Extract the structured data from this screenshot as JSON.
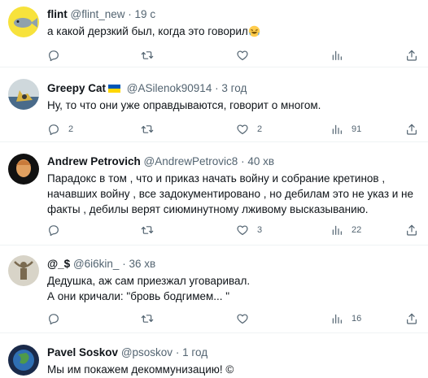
{
  "tweets": [
    {
      "name": "flint",
      "handle": "@flint_new",
      "sep": "·",
      "time": "19 с",
      "text": "а какой дерзкий был, когда это говорил",
      "emoji": "rolling-laughing-emoji",
      "reply_count": "",
      "retweet_count": "",
      "like_count": "",
      "view_count": ""
    },
    {
      "name": "Greepy Cat",
      "flag": "ukraine-flag",
      "handle": "@ASilenok90914",
      "sep": "·",
      "time": "3 год",
      "text": "Ну, то что они уже оправдываются, говорит о многом.",
      "reply_count": "2",
      "retweet_count": "",
      "like_count": "2",
      "view_count": "91"
    },
    {
      "name": "Andrew Petrovich",
      "handle": "@AndrewPetrovic8",
      "sep": "·",
      "time": "40 хв",
      "text": "Парадокс в том , что и приказ начать войну и собрание кретинов , начавших войну , все задокументировано , но дебилам это не указ и не факты , дебилы верят сиюминутному лживому высказыванию.",
      "reply_count": "",
      "retweet_count": "",
      "like_count": "3",
      "view_count": "22"
    },
    {
      "name": "@_$",
      "handle": "@6i6kin_",
      "sep": "·",
      "time": "36 хв",
      "text_line1": "Дедушка, аж сам приезжал уговаривал.",
      "text_line2": "А они кричали: \"бровь бодгимем... \"",
      "reply_count": "",
      "retweet_count": "",
      "like_count": "",
      "view_count": "16"
    },
    {
      "name": "Pavel Soskov",
      "handle": "@psoskov",
      "sep": "·",
      "time": "1 год",
      "text": "Мы им покажем декоммунизацию! ©"
    }
  ],
  "colors": {
    "text": "#0f1419",
    "secondary": "#536471",
    "divider": "#eff3f4",
    "flag_blue": "#0057b7",
    "flag_yellow": "#ffd700"
  }
}
